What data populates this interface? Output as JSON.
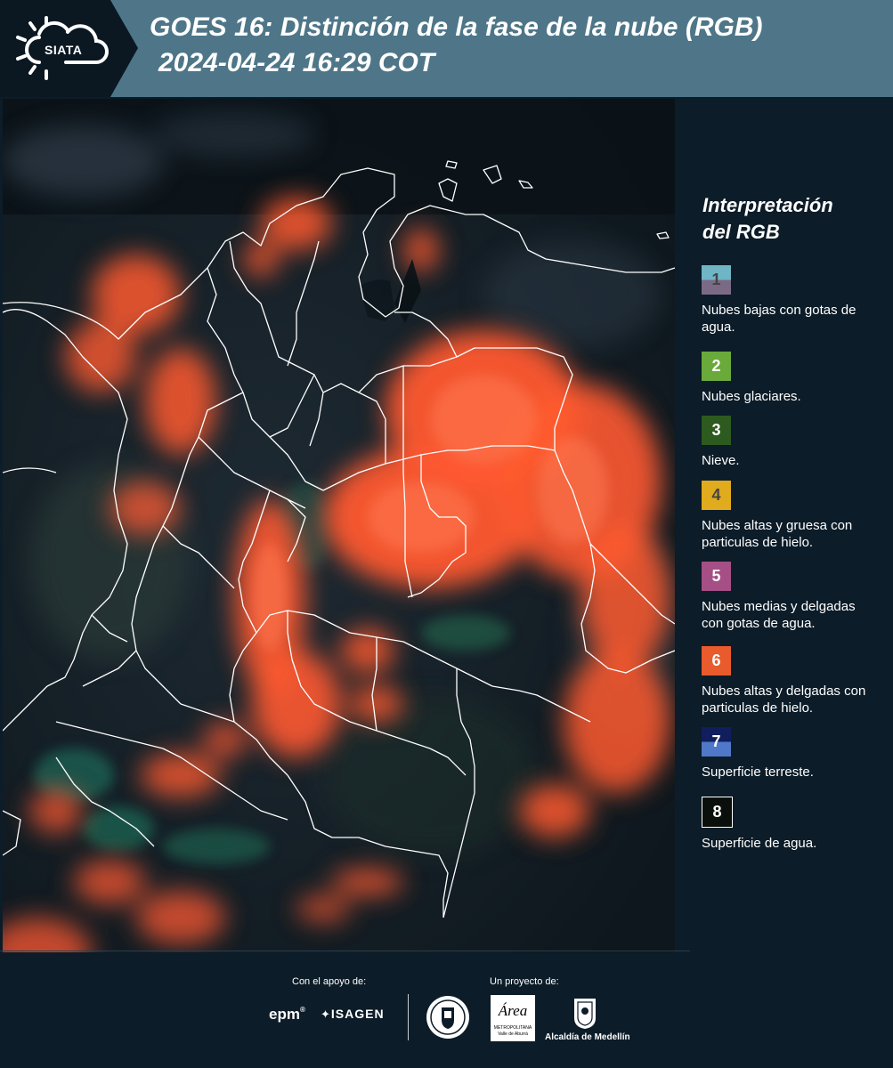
{
  "header": {
    "logo_text": "SIATA",
    "title_line1": "GOES 16: Distinción de la fase de la nube (RGB)",
    "title_line2": "2024-04-24 16:29 COT"
  },
  "legend": {
    "title_line1": "Interpretación",
    "title_line2": "del RGB",
    "items": [
      {
        "num": "1",
        "label": "Nubes bajas con gotas de agua.",
        "top": "#6fb5c6",
        "bottom": "#7b6a86",
        "text_color": "#444444"
      },
      {
        "num": "2",
        "label": "Nubes glaciares.",
        "top": "#6aaa3a",
        "bottom": "#6aaa3a",
        "text_color": "#ffffff"
      },
      {
        "num": "3",
        "label": "Nieve.",
        "top": "#2d5a1e",
        "bottom": "#2d5a1e",
        "text_color": "#ffffff"
      },
      {
        "num": "4",
        "label": "Nubes altas y gruesa con particulas de hielo.",
        "top": "#e0ab1c",
        "bottom": "#e0ab1c",
        "text_color": "#444444"
      },
      {
        "num": "5",
        "label": "Nubes medias y delgadas con gotas de agua.",
        "top": "#a64f86",
        "bottom": "#a64f86",
        "text_color": "#ffffff"
      },
      {
        "num": "6",
        "label": "Nubes altas y delgadas con particulas de hielo.",
        "top": "#e95a2c",
        "bottom": "#e95a2c",
        "text_color": "#ffffff"
      },
      {
        "num": "7",
        "label": "Superficie terreste.",
        "top": "#101e5e",
        "bottom": "#4f78c8",
        "text_color": "#ffffff"
      },
      {
        "num": "8",
        "label": "Superficie de agua.",
        "top": "#0a0f0c",
        "bottom": "#0a0f0c",
        "text_color": "#ffffff"
      }
    ]
  },
  "footer": {
    "support_label": "Con el apoyo de:",
    "project_label": "Un proyecto de:",
    "sponsors": [
      "epm",
      "ISAGEN"
    ],
    "partners": [
      "Área",
      "METROPOLITANA",
      "Valle de Aburrá",
      "Alcaldía de Medellín"
    ]
  },
  "colors": {
    "header_bg": "#4e7688",
    "panel_bg": "#0c1c28",
    "cloud_orange": "#ff5a30",
    "border_white": "#ffffff"
  }
}
